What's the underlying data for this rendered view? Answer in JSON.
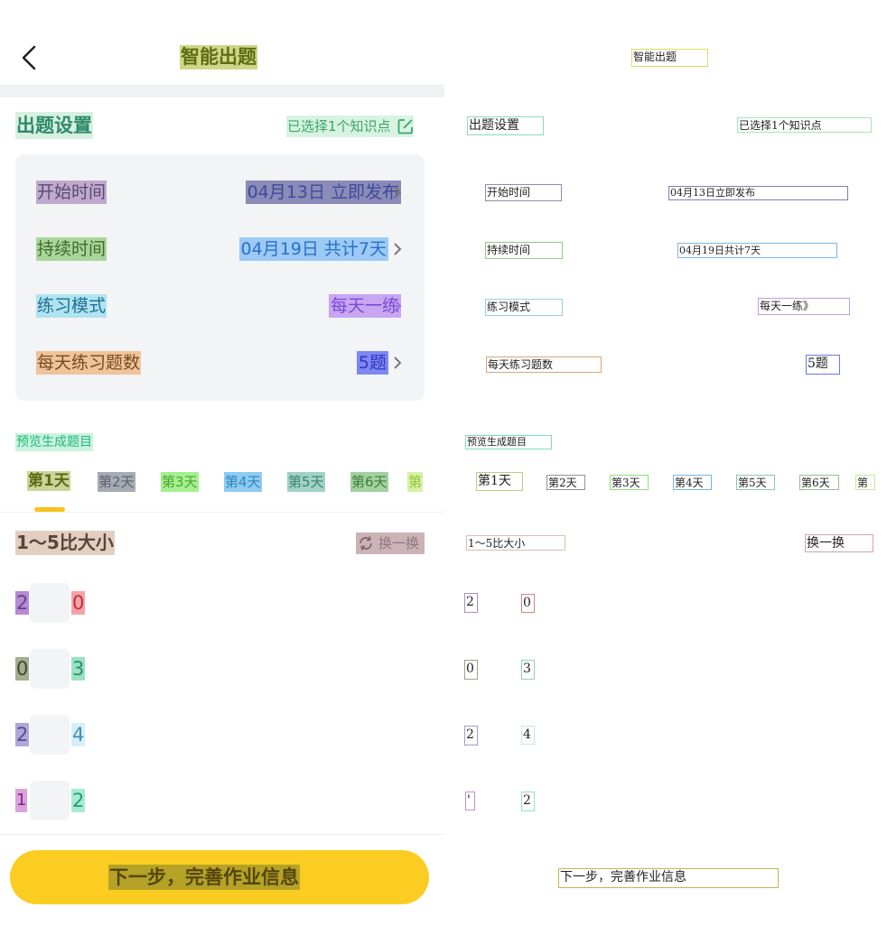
{
  "header": {
    "title": "智能出题"
  },
  "section": {
    "title": "出题设置",
    "selected_text": "已选择1个知识点"
  },
  "settings": [
    {
      "label": "开始时间",
      "value": "04月13日 立即发布"
    },
    {
      "label": "持续时间",
      "value": "04月19日 共计7天"
    },
    {
      "label": "练习模式",
      "value": "每天一练"
    },
    {
      "label": "每天练习题数",
      "value": "5题"
    }
  ],
  "preview": {
    "label": "预览生成题目"
  },
  "days": [
    "第1天",
    "第2天",
    "第3天",
    "第4天",
    "第5天",
    "第6天",
    "第"
  ],
  "question": {
    "title": "1～5比大小",
    "swap_label": "换一换",
    "pairs": [
      {
        "a": "2",
        "b": "0"
      },
      {
        "a": "0",
        "b": "3"
      },
      {
        "a": "2",
        "b": "4"
      },
      {
        "a": "1",
        "b": "2"
      }
    ]
  },
  "footer": {
    "next_label": "下一步，完善作业信息"
  },
  "annotations": {
    "title": "智能出题",
    "section_title": "出题设置",
    "selected": "已选择1个知识点",
    "start_label": "开始时间",
    "start_value": "04月13日立即发布",
    "dur_label": "持续时间",
    "dur_value": "04月19日共计7天",
    "mode_label": "练习模式",
    "mode_value": "每天一练》",
    "count_label": "每天练习题数",
    "count_value": "5题",
    "preview": "预览生成题目",
    "day1": "第1天",
    "day2": "第2天",
    "day3": "第3天",
    "day4": "第4天",
    "day5": "第5天",
    "day6": "第6天",
    "day7": "第",
    "q_title": "1～5比大小",
    "swap": "换一换",
    "p1a": "2",
    "p1b": "0",
    "p2a": "0",
    "p2b": "3",
    "p3a": "2",
    "p3b": "4",
    "p4a": "'",
    "p4b": "2",
    "next": "下一步，完善作业信息"
  }
}
